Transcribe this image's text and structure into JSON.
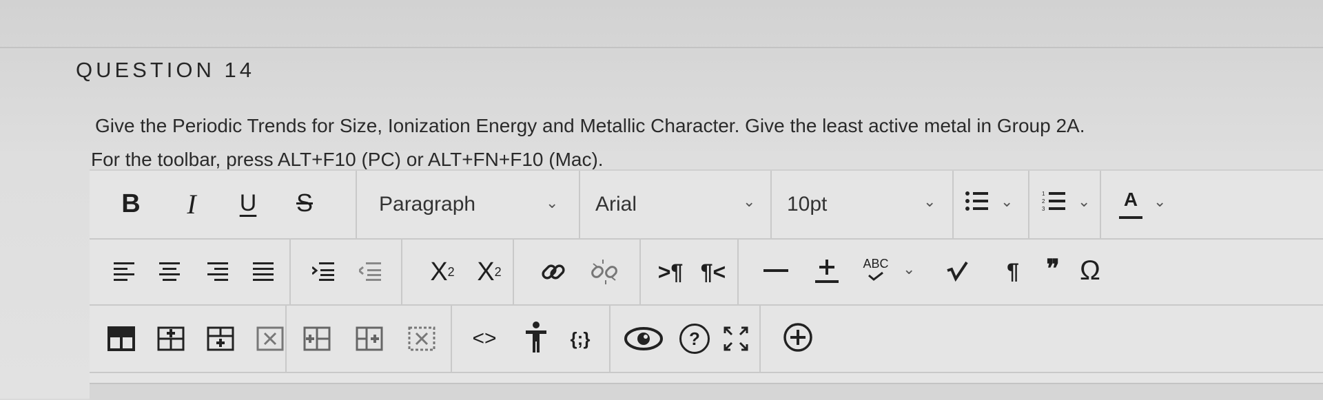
{
  "question": {
    "title": "QUESTION 14",
    "text": "Give the Periodic Trends for Size, Ionization Energy and Metallic Character.  Give the least active metal in Group 2A.",
    "toolbar_hint": "For the toolbar, press ALT+F10 (PC) or ALT+FN+F10 (Mac)."
  },
  "toolbar": {
    "bold": "B",
    "italic": "I",
    "underline": "U",
    "strikethrough": "S",
    "paragraph": "Paragraph",
    "font": "Arial",
    "font_size": "10pt",
    "text_color": "A",
    "spellcheck": "ABC",
    "superscript": "X",
    "superscript_sup": "2",
    "subscript": "X",
    "subscript_sub": "2",
    "pilcrow_ltr": ">¶",
    "pilcrow_rtl": "¶<",
    "pilcrow": "¶",
    "quote": "❞",
    "omega": "Ω",
    "code": "<>",
    "braces": "{;}",
    "help": "?"
  },
  "icons": [
    "bold-icon",
    "italic-icon",
    "underline-icon",
    "strikethrough-icon",
    "bullet-list-icon",
    "numbered-list-icon",
    "text-color-icon",
    "align-left-icon",
    "align-center-icon",
    "align-right-icon",
    "justify-icon",
    "indent-icon",
    "outdent-icon",
    "superscript-icon",
    "subscript-icon",
    "link-icon",
    "unlink-icon",
    "ltr-icon",
    "rtl-icon",
    "horizontal-line-icon",
    "plus-minus-icon",
    "spellcheck-icon",
    "math-icon",
    "pilcrow-icon",
    "quote-icon",
    "omega-icon",
    "table-icon",
    "insert-row-icon",
    "insert-row-below-icon",
    "delete-table-icon",
    "insert-column-icon",
    "insert-column-after-icon",
    "delete-cell-icon",
    "code-icon",
    "accessibility-icon",
    "code-block-icon",
    "preview-icon",
    "help-icon",
    "fullscreen-icon",
    "add-content-icon"
  ]
}
